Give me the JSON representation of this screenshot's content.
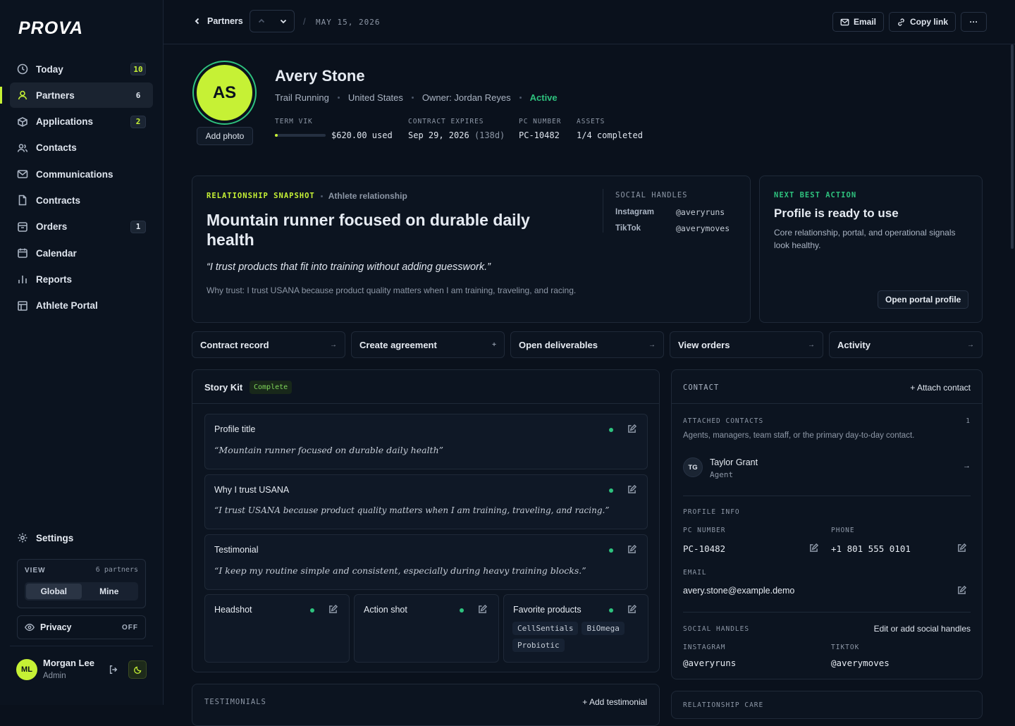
{
  "app": {
    "logo": "PROVA"
  },
  "sidebar": {
    "items": [
      {
        "label": "Today",
        "badge": "10",
        "badge_style": "lime"
      },
      {
        "label": "Partners",
        "badge": "6",
        "active": true
      },
      {
        "label": "Applications",
        "badge": "2",
        "badge_style": "lime"
      },
      {
        "label": "Contacts"
      },
      {
        "label": "Communications"
      },
      {
        "label": "Contracts"
      },
      {
        "label": "Orders",
        "badge": "1"
      },
      {
        "label": "Calendar"
      },
      {
        "label": "Reports"
      },
      {
        "label": "Athlete Portal"
      }
    ],
    "settings_label": "Settings",
    "view": {
      "label": "VIEW",
      "count": "6 partners",
      "options": [
        "Global",
        "Mine"
      ],
      "selected": "Global"
    },
    "privacy": {
      "label": "Privacy",
      "state": "OFF"
    },
    "user": {
      "initials": "ML",
      "name": "Morgan Lee",
      "role": "Admin"
    }
  },
  "topbar": {
    "back_label": "Partners",
    "date": "MAY 15, 2026",
    "email_label": "Email",
    "copy_label": "Copy link",
    "more_label": "···"
  },
  "profile": {
    "initials": "AS",
    "add_photo": "Add photo",
    "name": "Avery Stone",
    "sport": "Trail Running",
    "country": "United States",
    "owner": "Owner: Jordan Reyes",
    "status": "Active",
    "stats": {
      "term_label": "TERM VIK",
      "term_value": "$620.00 used",
      "term_fraction": 0.06,
      "contract_label": "CONTRACT EXPIRES",
      "contract_value": "Sep 29, 2026",
      "contract_days": "(138d)",
      "pc_label": "PC NUMBER",
      "pc_value": "PC-10482",
      "assets_label": "ASSETS",
      "assets_value": "1/4 completed"
    }
  },
  "snapshot": {
    "eyebrow": "RELATIONSHIP SNAPSHOT",
    "sub": "Athlete relationship",
    "headline": "Mountain runner focused on durable daily health",
    "quote": "“I trust products that fit into training without adding guesswork.”",
    "why": "Why trust: I trust USANA because product quality matters when I am training, traveling, and racing.",
    "social_title": "SOCIAL HANDLES",
    "social": [
      {
        "platform": "Instagram",
        "handle": "@averyruns"
      },
      {
        "platform": "TikTok",
        "handle": "@averymoves"
      }
    ]
  },
  "next_action": {
    "eyebrow": "NEXT BEST ACTION",
    "title": "Profile is ready to use",
    "body": "Core relationship, portal, and operational signals look healthy.",
    "button": "Open portal profile"
  },
  "actions": [
    {
      "label": "Contract record",
      "icon": "→"
    },
    {
      "label": "Create agreement",
      "icon": "+"
    },
    {
      "label": "Open deliverables",
      "icon": "→"
    },
    {
      "label": "View orders",
      "icon": "→"
    },
    {
      "label": "Activity",
      "icon": "→"
    }
  ],
  "story_kit": {
    "title": "Story Kit",
    "status": "Complete",
    "fields": [
      {
        "title": "Profile title",
        "value": "“Mountain runner focused on durable daily health”"
      },
      {
        "title": "Why I trust USANA",
        "value": "“I trust USANA because product quality matters when I am training, traveling, and racing.”"
      },
      {
        "title": "Testimonial",
        "value": "“I keep my routine simple and consistent, especially during heavy training blocks.”"
      }
    ],
    "assets": [
      {
        "title": "Headshot"
      },
      {
        "title": "Action shot"
      },
      {
        "title": "Favorite products",
        "chips": [
          "CellSentials",
          "BiOmega",
          "Probiotic"
        ]
      }
    ]
  },
  "testimonials": {
    "title": "TESTIMONIALS",
    "add": "+ Add testimonial"
  },
  "contact": {
    "title": "CONTACT",
    "attach": "+ Attach contact",
    "attached_label": "ATTACHED CONTACTS",
    "attached_count": "1",
    "attached_desc": "Agents, managers, team staff, or the primary day-to-day contact.",
    "person": {
      "initials": "TG",
      "name": "Taylor Grant",
      "role": "Agent"
    },
    "profile_info": "PROFILE INFO",
    "pc_label": "PC NUMBER",
    "pc_value": "PC-10482",
    "phone_label": "PHONE",
    "phone_value": "+1 801 555 0101",
    "email_label": "EMAIL",
    "email_value": "avery.stone@example.demo",
    "social_label": "SOCIAL HANDLES",
    "social_edit": "Edit or add social handles",
    "ig_label": "INSTAGRAM",
    "ig_value": "@averyruns",
    "tt_label": "TIKTOK",
    "tt_value": "@averymoves",
    "next_section": "RELATIONSHIP CARE"
  },
  "colors": {
    "accent": "#c6f135",
    "success": "#2ec27e",
    "bg": "#0a111c"
  }
}
